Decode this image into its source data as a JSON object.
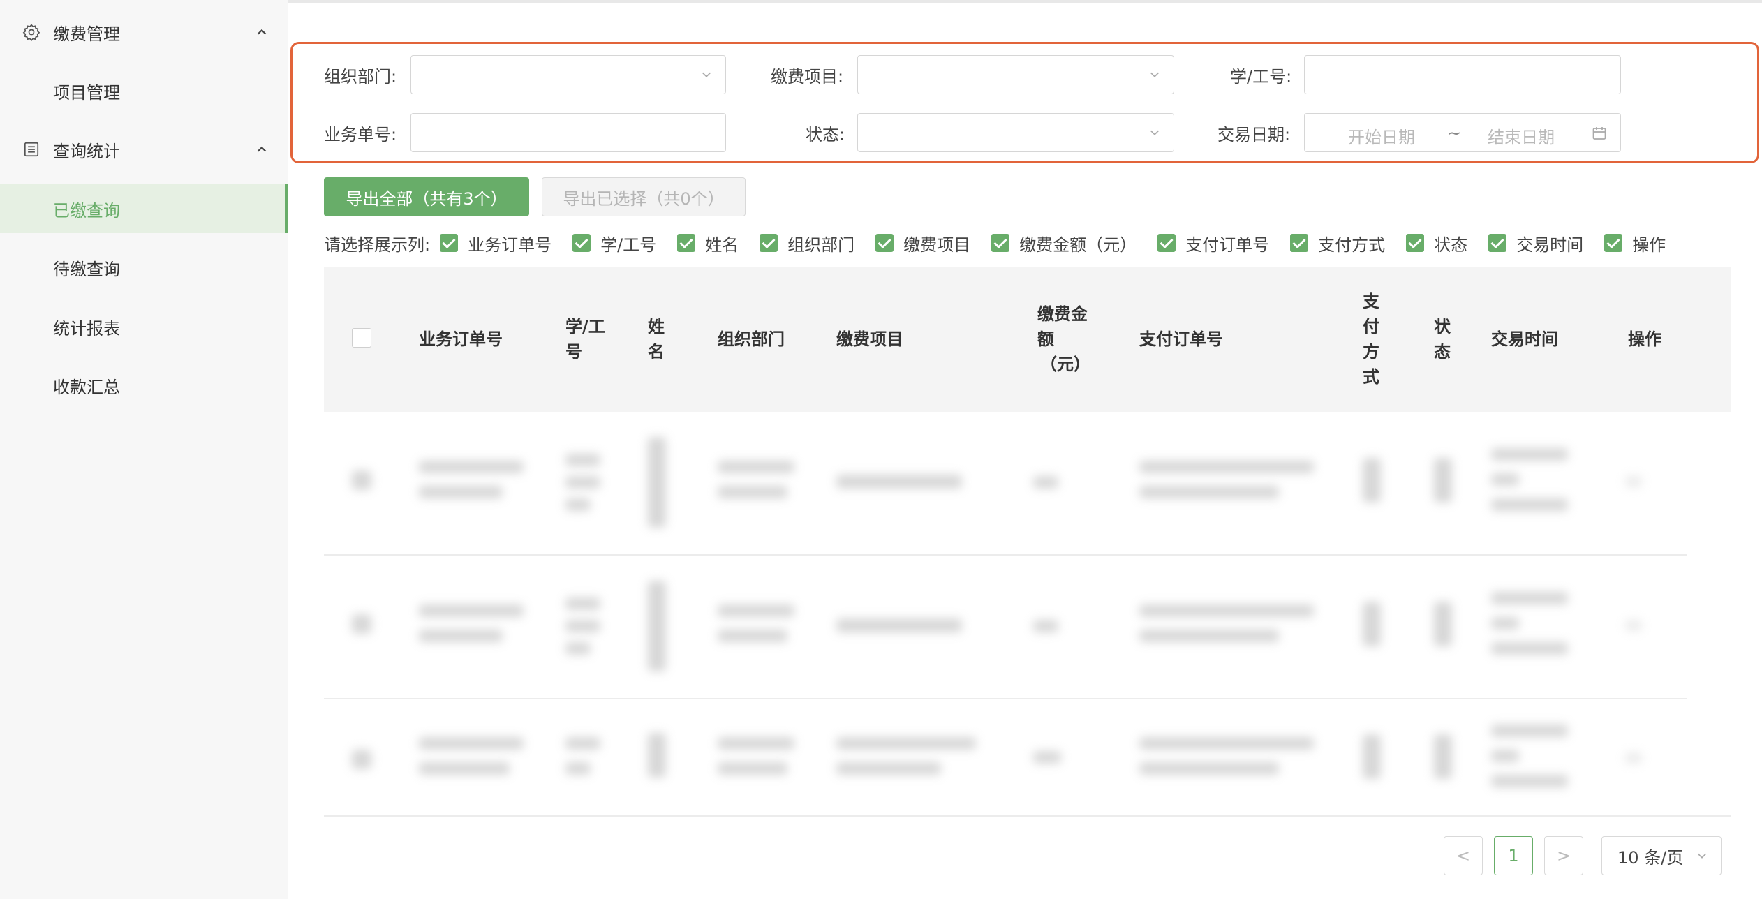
{
  "sidebar": {
    "groups": [
      {
        "label": "缴费管理",
        "icon": "gear-icon"
      },
      {
        "label": "查询统计",
        "icon": "list-icon"
      }
    ],
    "items": [
      {
        "label": "项目管理",
        "active": false
      },
      {
        "label": "已缴查询",
        "active": true
      },
      {
        "label": "待缴查询",
        "active": false
      },
      {
        "label": "统计报表",
        "active": false
      },
      {
        "label": "收款汇总",
        "active": false
      }
    ]
  },
  "filters": {
    "org_dept": {
      "label": "组织部门:",
      "value": ""
    },
    "fee_item": {
      "label": "缴费项目:",
      "value": ""
    },
    "student_id": {
      "label": "学/工号:",
      "value": ""
    },
    "biz_order": {
      "label": "业务单号:",
      "value": ""
    },
    "status": {
      "label": "状态:",
      "value": ""
    },
    "trade_date": {
      "label": "交易日期:",
      "start_placeholder": "开始日期",
      "separator": "~",
      "end_placeholder": "结束日期"
    }
  },
  "actions": {
    "export_all": "导出全部（共有3个）",
    "export_selected": "导出已选择（共0个）"
  },
  "columns": {
    "prefix": "请选择展示列:",
    "options": [
      "业务订单号",
      "学/工号",
      "姓名",
      "组织部门",
      "缴费项目",
      "缴费金额（元）",
      "支付订单号",
      "支付方式",
      "状态",
      "交易时间",
      "操作"
    ]
  },
  "table": {
    "headers": {
      "order_no": "业务订单号",
      "student_id_l1": "学/工",
      "student_id_l2": "号",
      "name_l1": "姓",
      "name_l2": "名",
      "dept": "组织部门",
      "fee_item": "缴费项目",
      "amount_l1": "缴费金",
      "amount_l2": "额",
      "amount_l3": "（元）",
      "pay_order": "支付订单号",
      "pay_method_l1": "支",
      "pay_method_l2": "付",
      "pay_method_l3": "方",
      "pay_method_l4": "式",
      "status_l1": "状",
      "status_l2": "态",
      "trade_time": "交易时间",
      "operation": "操作"
    },
    "row_count": 3
  },
  "pagination": {
    "prev": "<",
    "current": "1",
    "next": ">",
    "page_size": "10 条/页"
  },
  "colors": {
    "accent": "#68ad69",
    "highlight_border": "#e2643a"
  }
}
